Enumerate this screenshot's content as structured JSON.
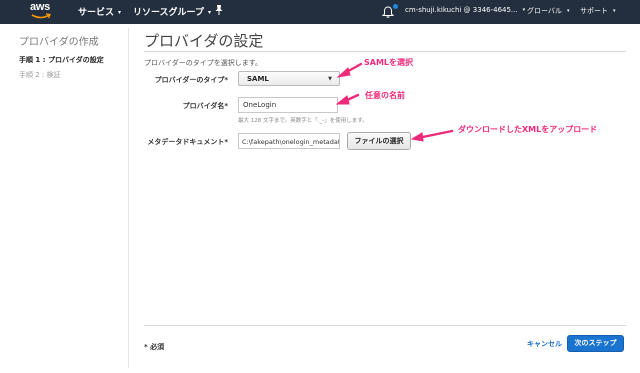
{
  "topbar": {
    "logo": "aws",
    "services_label": "サービス",
    "resource_groups_label": "リソースグループ",
    "pin_icon": "pin-icon",
    "bell_icon": "bell-icon",
    "account_label": "cm-shuji.kikuchi @ 3346-4645...",
    "region_label": "グローバル",
    "support_label": "サポート",
    "caret": "▾"
  },
  "sidebar": {
    "title": "プロバイダの作成",
    "steps": [
      {
        "label": "手順 1 : プロバイダの設定",
        "active": true
      },
      {
        "label": "手順 2 : 検証",
        "active": false
      }
    ]
  },
  "main": {
    "title": "プロバイダの設定",
    "subtitle": "プロバイダーのタイプを選択します。",
    "fields": {
      "provider_type": {
        "label": "プロバイダーのタイプ*",
        "value": "SAML",
        "caret": "▼"
      },
      "provider_name": {
        "label": "プロバイダ名*",
        "value": "OneLogin",
        "hint": "最大 128 文字まで。英数字と「._-」を使用します。"
      },
      "metadata": {
        "label": "メタデータドキュメント*",
        "file_path": "C:\\fakepath\\onelogin_metadata_",
        "button_label": "ファイルの選択"
      }
    }
  },
  "annotations": {
    "saml": "SAMLを選択",
    "name": "任意の名前",
    "upload": "ダウンロードしたXMLをアップロード",
    "color": "#ee2a7b"
  },
  "footer": {
    "required_note": "* 必須",
    "cancel_label": "キャンセル",
    "next_label": "次のステップ"
  }
}
